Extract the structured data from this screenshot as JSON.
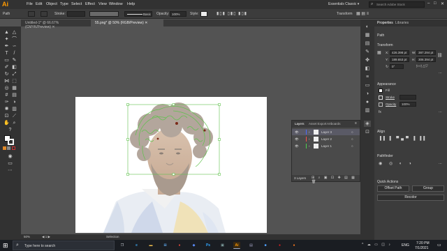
{
  "app": {
    "logo": "Ai"
  },
  "menu": [
    "File",
    "Edit",
    "Object",
    "Type",
    "Select",
    "Effect",
    "View",
    "Window",
    "Help"
  ],
  "workspace": "Essentials Classic",
  "search_placeholder": "Search Adobe Stock",
  "control_bar": {
    "path_label": "Path",
    "stroke_label": "Stroke:",
    "stroke_profile": "Basic",
    "opacity_label": "Opacity:",
    "opacity_value": "100%",
    "style_label": "Style:",
    "transform_label": "Transform"
  },
  "tabs": [
    {
      "label": "Untitled-1* @ 66.67% (CMYK/Preview)"
    },
    {
      "label": "55.png* @ 50% (RGB/Preview)"
    }
  ],
  "layers_panel": {
    "tabs": [
      "Layers",
      "Asset Export",
      "Artboards"
    ],
    "layers": [
      {
        "name": "Layer 3",
        "color": "#4f6cff"
      },
      {
        "name": "Layer 2",
        "color": "#ff4f4f"
      },
      {
        "name": "Layer 1",
        "color": "#4fd24f"
      }
    ],
    "count": "3 Layers"
  },
  "properties": {
    "tabs": [
      "Properties",
      "Libraries"
    ],
    "selection_type": "Path",
    "transform": {
      "title": "Transform",
      "x_label": "X:",
      "x": "426.398 pt",
      "y_label": "Y:",
      "y": "189.653 pt",
      "w_label": "W:",
      "w": "387.294 pt",
      "h_label": "H:",
      "h": "306.394 pt",
      "angle": "0°"
    },
    "appearance": {
      "title": "Appearance",
      "fill_label": "Fill",
      "stroke_label": "Stroke",
      "opacity_label": "Opacity",
      "opacity_value": "100%"
    },
    "align_title": "Align",
    "pathfinder_title": "Pathfinder",
    "quick_actions": {
      "title": "Quick Actions",
      "offset_path": "Offset Path",
      "group": "Group",
      "recolor": "Recolor"
    }
  },
  "status_bar": {
    "zoom": "50%",
    "page": "1",
    "tool": "Selection"
  },
  "taskbar": {
    "search_placeholder": "Type here to search",
    "language": "ENG",
    "time": "7:20 PM",
    "date": "7/1/2021",
    "apps": [
      {
        "name": "task-view",
        "glyph": "❐",
        "color": "#cfd4da"
      },
      {
        "name": "edge",
        "glyph": "e",
        "color": "#3aa0e6"
      },
      {
        "name": "folder",
        "glyph": "▬",
        "color": "#f2c14e"
      },
      {
        "name": "store",
        "glyph": "⊞",
        "color": "#5aa0e0"
      },
      {
        "name": "chrome",
        "glyph": "●",
        "color": "#e34a3a"
      },
      {
        "name": "unknown",
        "glyph": "◆",
        "color": "#5b8dff"
      },
      {
        "name": "photoshop",
        "glyph": "Ps",
        "color": "#31a8ff"
      },
      {
        "name": "unknown2",
        "glyph": "▣",
        "color": "#8aa"
      },
      {
        "name": "illustrator",
        "glyph": "Ai",
        "color": "#ff9a00"
      },
      {
        "name": "unknown3",
        "glyph": "▤",
        "color": "#aac"
      },
      {
        "name": "unknown4",
        "glyph": "■",
        "color": "#4fa3ff"
      },
      {
        "name": "unknown5",
        "glyph": "●",
        "color": "#e02020"
      },
      {
        "name": "firefox",
        "glyph": "●",
        "color": "#ff7a1a"
      }
    ]
  }
}
